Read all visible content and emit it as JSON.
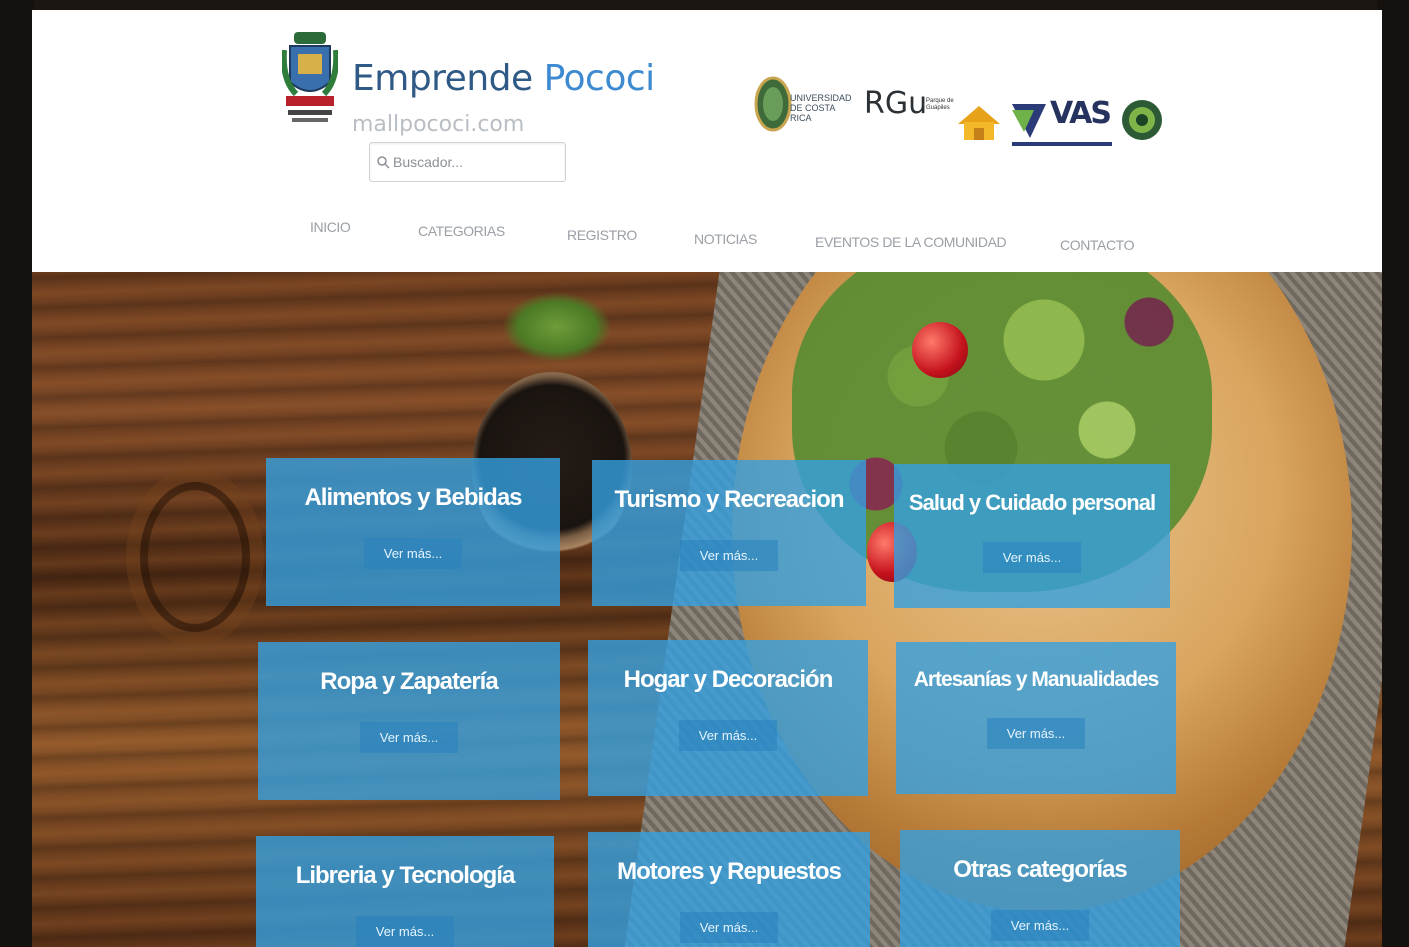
{
  "site": {
    "title_main": "Emprende",
    "title_accent": "Pococi",
    "domain": "mallpococi.com"
  },
  "search": {
    "placeholder": "Buscador..."
  },
  "sponsors": {
    "ucr_text": "UNIVERSIDAD DE COSTA RICA",
    "rgu_text": "RGu",
    "parque_text": "Parque de Guápiles",
    "vas_text": "VAS"
  },
  "nav": {
    "items": [
      {
        "label": "INICIO"
      },
      {
        "label": "CATEGORIAS"
      },
      {
        "label": "REGISTRO"
      },
      {
        "label": "NOTICIAS"
      },
      {
        "label": "EVENTOS DE LA COMUNIDAD"
      },
      {
        "label": "CONTACTO"
      }
    ]
  },
  "categories": [
    {
      "title": "Alimentos y Bebidas",
      "button": "Ver más..."
    },
    {
      "title": "Turismo y Recreacion",
      "button": "Ver más..."
    },
    {
      "title": "Salud y Cuidado personal",
      "button": "Ver más..."
    },
    {
      "title": "Ropa y Zapatería",
      "button": "Ver más..."
    },
    {
      "title": "Hogar y Decoración",
      "button": "Ver más..."
    },
    {
      "title": "Artesanías y Manualidades",
      "button": "Ver más..."
    },
    {
      "title": "Libreria y Tecnología",
      "button": "Ver más..."
    },
    {
      "title": "Motores y Repuestos",
      "button": "Ver más..."
    },
    {
      "title": "Otras categorías",
      "button": "Ver más..."
    }
  ],
  "colors": {
    "brand": "#2f5a86",
    "brand_accent": "#3d8ad0",
    "tile_blue": "#34a0e1"
  }
}
